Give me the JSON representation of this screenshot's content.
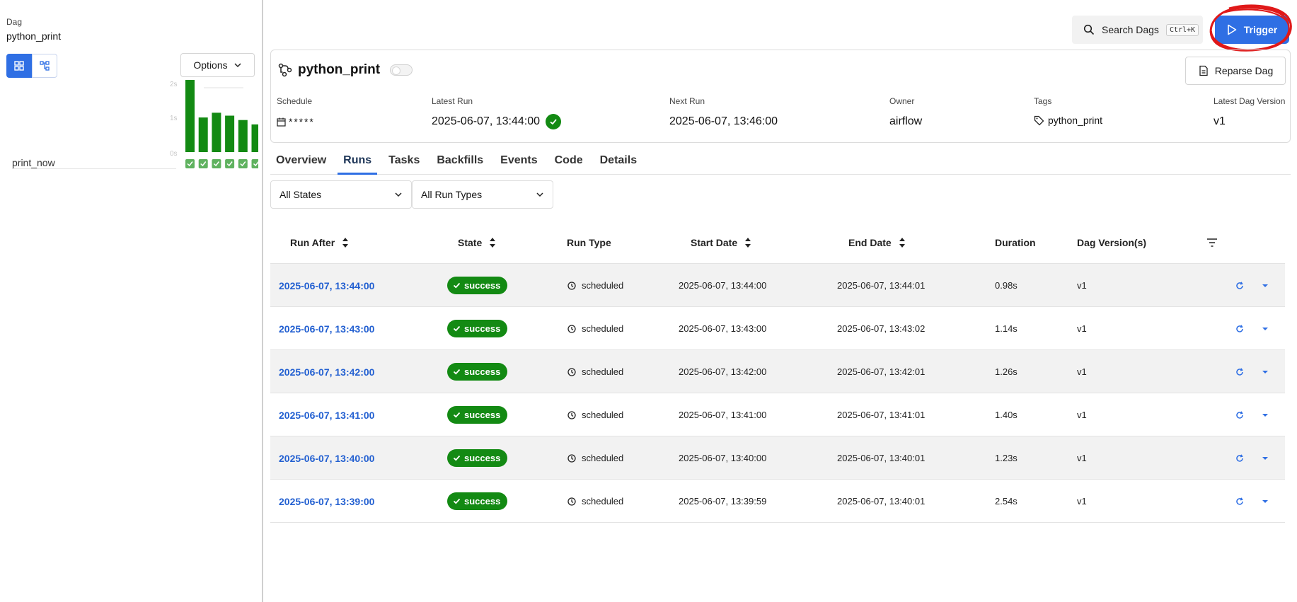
{
  "breadcrumb": {
    "label": "Dag",
    "value": "python_print"
  },
  "left": {
    "options_label": "Options",
    "task_label": "print_now",
    "duration_axis": [
      "2s",
      "1s",
      "0s"
    ],
    "run_bar_durations_s": [
      1.98,
      0.95,
      1.08,
      1.0,
      0.88,
      0.76
    ]
  },
  "header": {
    "search_label": "Search Dags",
    "search_shortcut": "Ctrl+K",
    "trigger_label": "Trigger"
  },
  "dag": {
    "title": "python_print",
    "reparse_label": "Reparse Dag",
    "schedule": {
      "label": "Schedule",
      "value": "* * * * *"
    },
    "latest_run": {
      "label": "Latest Run",
      "value": "2025-06-07, 13:44:00"
    },
    "next_run": {
      "label": "Next Run",
      "value": "2025-06-07, 13:46:00"
    },
    "owner": {
      "label": "Owner",
      "value": "airflow"
    },
    "tags": {
      "label": "Tags",
      "value": "python_print"
    },
    "version": {
      "label": "Latest Dag Version",
      "value": "v1"
    }
  },
  "tabs": [
    "Overview",
    "Runs",
    "Tasks",
    "Backfills",
    "Events",
    "Code",
    "Details"
  ],
  "active_tab": "Runs",
  "filters": {
    "state": "All States",
    "run_type": "All Run Types"
  },
  "table": {
    "headers": {
      "run_after": "Run After",
      "state": "State",
      "run_type": "Run Type",
      "start_date": "Start Date",
      "end_date": "End Date",
      "duration": "Duration",
      "dag_versions": "Dag Version(s)"
    },
    "rows": [
      {
        "run_after": "2025-06-07, 13:44:00",
        "state": "success",
        "run_type": "scheduled",
        "start": "2025-06-07, 13:44:00",
        "end": "2025-06-07, 13:44:01",
        "duration": "0.98s",
        "version": "v1"
      },
      {
        "run_after": "2025-06-07, 13:43:00",
        "state": "success",
        "run_type": "scheduled",
        "start": "2025-06-07, 13:43:00",
        "end": "2025-06-07, 13:43:02",
        "duration": "1.14s",
        "version": "v1"
      },
      {
        "run_after": "2025-06-07, 13:42:00",
        "state": "success",
        "run_type": "scheduled",
        "start": "2025-06-07, 13:42:00",
        "end": "2025-06-07, 13:42:01",
        "duration": "1.26s",
        "version": "v1"
      },
      {
        "run_after": "2025-06-07, 13:41:00",
        "state": "success",
        "run_type": "scheduled",
        "start": "2025-06-07, 13:41:00",
        "end": "2025-06-07, 13:41:01",
        "duration": "1.40s",
        "version": "v1"
      },
      {
        "run_after": "2025-06-07, 13:40:00",
        "state": "success",
        "run_type": "scheduled",
        "start": "2025-06-07, 13:40:00",
        "end": "2025-06-07, 13:40:01",
        "duration": "1.23s",
        "version": "v1"
      },
      {
        "run_after": "2025-06-07, 13:39:00",
        "state": "success",
        "run_type": "scheduled",
        "start": "2025-06-07, 13:39:59",
        "end": "2025-06-07, 13:40:01",
        "duration": "2.54s",
        "version": "v1"
      }
    ]
  },
  "colors": {
    "accent": "#2f6fe4",
    "success": "#138a13",
    "link": "#2360d1",
    "annotation": "#e01919"
  },
  "icons": [
    "grid-view-icon",
    "graph-view-icon",
    "chevron-down-icon",
    "search-icon",
    "play-icon",
    "dag-icon",
    "file-refresh-icon",
    "calendar-icon",
    "check-icon",
    "tag-icon",
    "sort-icon",
    "filter-icon",
    "clock-icon",
    "refresh-icon",
    "caret-down-icon"
  ]
}
